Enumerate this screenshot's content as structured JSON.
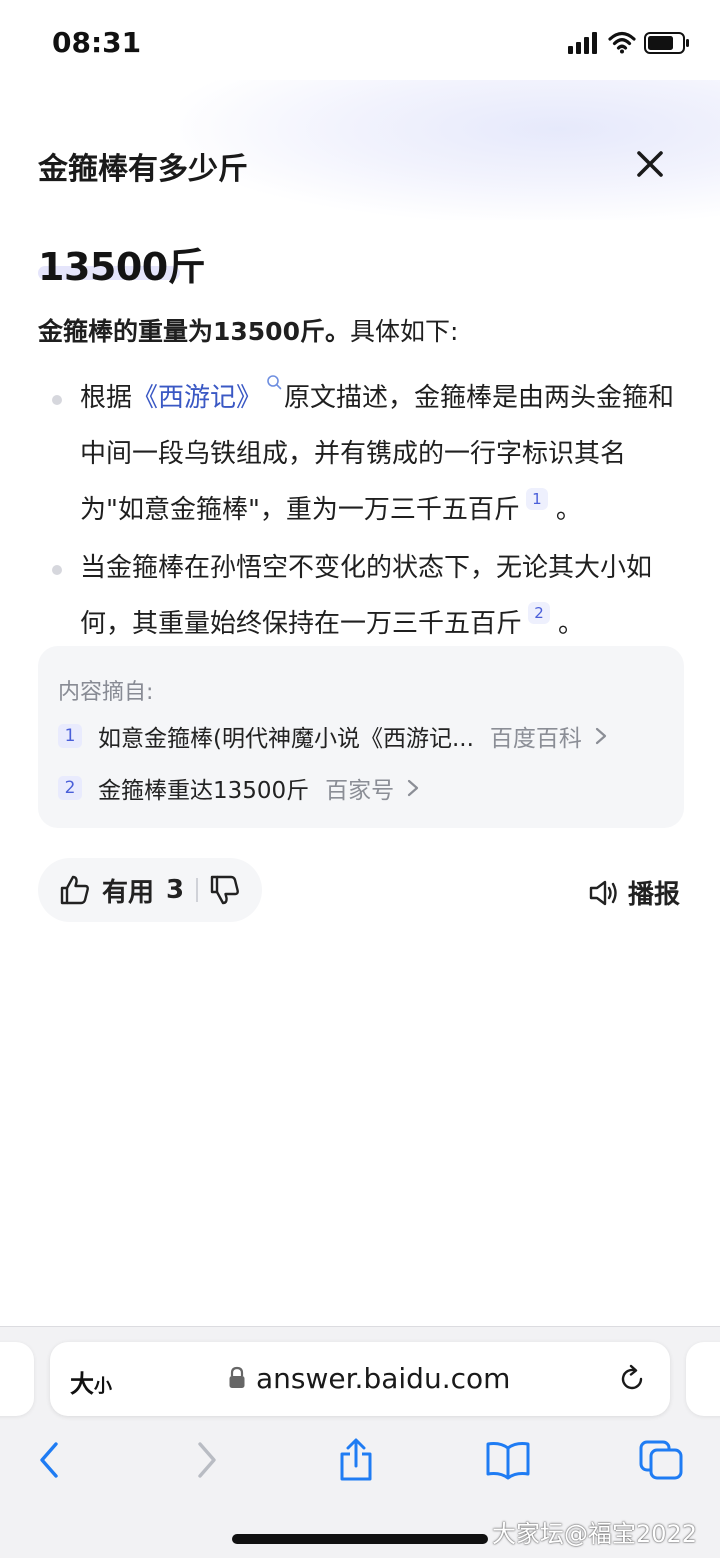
{
  "status_bar": {
    "time": "08:31"
  },
  "header": {
    "title": "金箍棒有多少斤"
  },
  "answer": {
    "headline": "13500斤",
    "summary_strong": "金箍棒的重量为13500斤。",
    "summary_rest": "具体如下:"
  },
  "bullets": [
    {
      "prefix": "根据",
      "link": "《西游记》",
      "text": "原文描述，金箍棒是由两头金箍和中间一段乌铁组成，并有镌成的一行字标识其名为\"如意金箍棒\"，重为一万三千五百斤",
      "cite": "1",
      "suffix": "。"
    },
    {
      "text": "当金箍棒在孙悟空不变化的状态下，无论其大小如何，其重量始终保持在一万三千五百斤",
      "cite": "2",
      "suffix": "。"
    }
  ],
  "sources": {
    "title": "内容摘自:",
    "items": [
      {
        "num": "1",
        "title": "如意金箍棒(明代神魔小说《西游记...",
        "site": "百度百科"
      },
      {
        "num": "2",
        "title": "金箍棒重达13500斤",
        "site": "百家号"
      }
    ]
  },
  "actions": {
    "useful_label": "有用",
    "useful_count": "3",
    "broadcast_label": "播报"
  },
  "browser": {
    "size_big": "大",
    "size_small": "小",
    "url": "answer.baidu.com"
  },
  "watermark": "大家坛@福宝2022",
  "icons": {
    "close": "close-icon",
    "thumb_up": "thumb-up-icon",
    "thumb_down": "thumb-down-icon",
    "speaker": "speaker-icon",
    "lock": "lock-icon",
    "reload": "reload-icon",
    "back": "chevron-left-icon",
    "forward": "chevron-right-icon",
    "share": "share-icon",
    "bookmarks": "book-icon",
    "tabs": "tabs-icon"
  },
  "colors": {
    "link": "#3a58c4",
    "accent": "#4a5fd9",
    "ios_blue": "#1f7cf3"
  }
}
